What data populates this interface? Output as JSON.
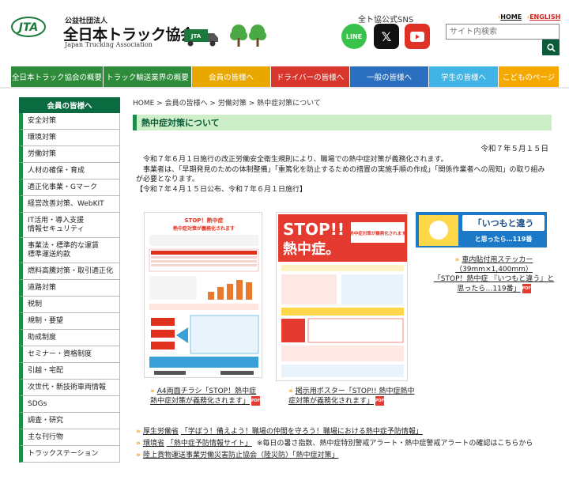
{
  "header": {
    "org_prefix": "公益社団法人",
    "org_name": "全日本トラック協会",
    "org_name_en": "Japan Trucking Association",
    "logo_letters": "JTA",
    "sns_title": "全ト協公式SNS",
    "sns_line": "LINE",
    "sns_x": "𝕏",
    "home_link": "HOME",
    "english_link": "ENGLISH",
    "search_placeholder": "サイト内検索"
  },
  "nav": [
    {
      "label": "全日本トラック協会の概要",
      "color": "#2e8b3a"
    },
    {
      "label": "トラック輸送業界の概要",
      "color": "#2e8b3a"
    },
    {
      "label": "会員の皆様へ",
      "color": "#e9a800"
    },
    {
      "label": "ドライバーの皆様へ",
      "color": "#d8352c"
    },
    {
      "label": "一般の皆様へ",
      "color": "#2a6fc0"
    },
    {
      "label": "学生の皆様へ",
      "color": "#40b5e5"
    },
    {
      "label": "こどものページ",
      "color": "#f5a800"
    }
  ],
  "sidebar": {
    "title": "会員の皆様へ",
    "items": [
      "安全対策",
      "環境対策",
      "労働対策",
      "人材の確保・育成",
      "適正化事業・Gマーク",
      "経営改善対策、WebKIT",
      "IT活用・導入支援\n情報セキュリティ",
      "事業法・標準的な運賃\n標準運送約款",
      "燃料高騰対策・取引適正化",
      "道路対策",
      "税制",
      "規制・要望",
      "助成制度",
      "セミナー・資格制度",
      "引越・宅配",
      "次世代・新技術車両情報",
      "SDGs",
      "調査・研究",
      "主な刊行物",
      "トラックステーション"
    ]
  },
  "main": {
    "breadcrumb": "HOME > 会員の皆様へ > 労働対策 > 熱中症対策について",
    "title": "熱中症対策について",
    "date": "令和７年５月１５日",
    "para1": "令和７年６月１日施行の改正労働安全衛生規則により、職場での熱中症対策が義務化されます。",
    "para2": "事業者は、「早期発見のための体制整備」「重篤化を防止するための措置の実施手順の作成」「関係作業者への周知」の取り組みが必要となります。",
    "para3": "【令和７年４月１５日公布、令和７年６月１日施行】",
    "flyer_title1": "STOP！熱中症",
    "flyer_title2": "熱中症対策が義務化されます",
    "poster_big": "STOP!!",
    "poster_big2": "熱中症。",
    "poster_sub": "熱中症対策が義務化されます",
    "sticker_text1": "「いつもと違う",
    "sticker_text2": "と思ったら…119番",
    "caption1": "A4両面チラシ「STOP！熱中症熱中症対策が義務化されます」",
    "caption2": "掲示用ポスター「STOP!! 熱中症熱中症対策が義務化されます」",
    "caption3a": "車内貼付用ステッカー",
    "caption3b": "（39mm×1,400mm）",
    "caption3c": "「STOP！熱中症 『いつもと違う』と思ったら…119番」",
    "pdf": "PDF"
  },
  "links": [
    {
      "prefix": "厚生労働省",
      "text": "「学ぼう！備えよう！職場の仲間を守ろう！職場における熱中症予防情報」",
      "suffix": ""
    },
    {
      "prefix": "環境省",
      "text": "「熱中症予防情報サイト」",
      "suffix": "※毎日の暑さ指数、熱中症特別警戒アラート・熱中症警戒アラートの確認はこちらから"
    },
    {
      "prefix": "",
      "text": "陸上貨物運送事業労働災害防止協会（陸災防）「熱中症対策」",
      "suffix": ""
    }
  ]
}
